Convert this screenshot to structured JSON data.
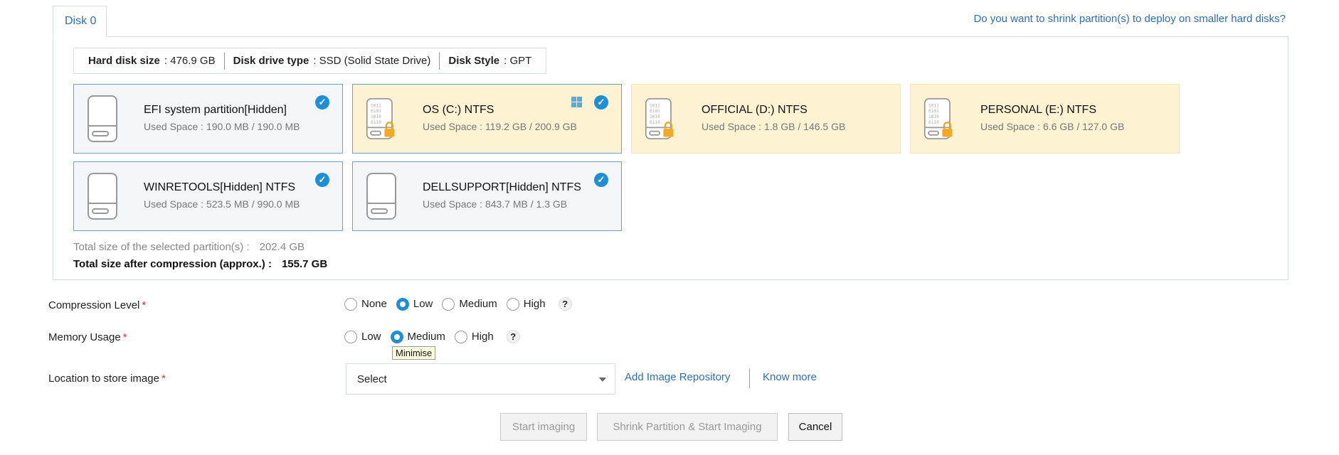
{
  "tabs": [
    {
      "label": "Disk 0"
    }
  ],
  "shrink_link": "Do you want to shrink partition(s) to deploy on smaller hard disks?",
  "disk_info": {
    "size_label": "Hard disk size",
    "size_value": ": 476.9 GB",
    "type_label": "Disk drive type",
    "type_value": ": SSD (Solid State Drive)",
    "style_label": "Disk Style",
    "style_value": ": GPT"
  },
  "partitions": [
    {
      "name": "EFI system partition[Hidden]",
      "used": "Used Space : 190.0 MB / 190.0 MB",
      "selected": true,
      "locked": false
    },
    {
      "name": "OS (C:) NTFS",
      "used": "Used Space : 119.2 GB / 200.9 GB",
      "selected": true,
      "locked": true,
      "windows": true
    },
    {
      "name": "OFFICIAL (D:) NTFS",
      "used": "Used Space : 1.8 GB / 146.5 GB",
      "selected": false,
      "locked": true
    },
    {
      "name": "PERSONAL (E:) NTFS",
      "used": "Used Space : 6.6 GB / 127.0 GB",
      "selected": false,
      "locked": true
    },
    {
      "name": "WINRETOOLS[Hidden] NTFS",
      "used": "Used Space : 523.5 MB / 990.0 MB",
      "selected": true,
      "locked": false
    },
    {
      "name": "DELLSUPPORT[Hidden] NTFS",
      "used": "Used Space : 843.7 MB / 1.3 GB",
      "selected": true,
      "locked": false
    }
  ],
  "totals": {
    "selected_label": "Total size of the selected partition(s) :",
    "selected_value": "202.4 GB",
    "compressed_label": "Total size after compression (approx.) :",
    "compressed_value": "155.7 GB"
  },
  "compression": {
    "label": "Compression Level",
    "required": "*",
    "options": [
      "None",
      "Low",
      "Medium",
      "High"
    ],
    "selected": "Low",
    "help": "?"
  },
  "memory": {
    "label": "Memory Usage",
    "required": "*",
    "options": [
      "Low",
      "Medium",
      "High"
    ],
    "selected": "Medium",
    "help": "?",
    "tooltip": "Minimise"
  },
  "location": {
    "label": "Location to store image",
    "required": "*",
    "select_value": "Select",
    "add_repo": "Add Image Repository",
    "know_more": "Know more"
  },
  "buttons": {
    "start": "Start imaging",
    "shrink_start": "Shrink Partition & Start Imaging",
    "cancel": "Cancel"
  },
  "colors": {
    "accent": "#1e8fd6",
    "link": "#2e6fb4",
    "highlight": "#fdf2d1"
  }
}
